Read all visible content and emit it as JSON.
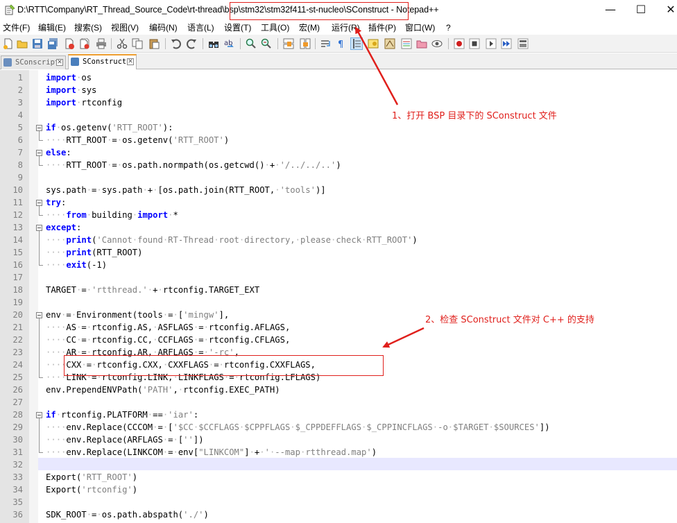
{
  "window": {
    "title_prefix": "D:\\RTT\\Company\\RT_Thread_Source_Code\\rt-thread\\",
    "title_highlight": "bsp\\stm32\\stm32f411-st-nucleo\\SConstruct",
    "title_suffix": " - Notepad++",
    "minimize": "—",
    "maximize": "☐",
    "close": "✕"
  },
  "menu": {
    "items": [
      "文件(F)",
      "编辑(E)",
      "搜索(S)",
      "视图(V)",
      "编码(N)",
      "语言(L)",
      "设置(T)",
      "工具(O)",
      "宏(M)",
      "运行(R)",
      "插件(P)",
      "窗口(W)",
      "?"
    ]
  },
  "tabs": [
    {
      "label": "SConscript",
      "active": false
    },
    {
      "label": "SConstruct",
      "active": true
    }
  ],
  "annotations": {
    "note1": "1、打开 BSP 目录下的 SConstruct 文件",
    "note2": "2、检查 SConstruct 文件对 C++ 的支持"
  },
  "editor": {
    "line_numbers": [
      "1",
      "2",
      "3",
      "4",
      "5",
      "6",
      "7",
      "8",
      "9",
      "10",
      "11",
      "12",
      "13",
      "14",
      "15",
      "16",
      "17",
      "18",
      "19",
      "20",
      "21",
      "22",
      "23",
      "24",
      "25",
      "26",
      "27",
      "28",
      "29",
      "30",
      "31",
      "32",
      "33",
      "34",
      "35",
      "36"
    ],
    "current_line": "32",
    "lines": [
      "import os",
      "import sys",
      "import rtconfig",
      "",
      "if os.getenv('RTT_ROOT'):",
      "    RTT_ROOT = os.getenv('RTT_ROOT')",
      "else:",
      "    RTT_ROOT = os.path.normpath(os.getcwd() + '/../../..')",
      "",
      "sys.path = sys.path + [os.path.join(RTT_ROOT, 'tools')]",
      "try:",
      "    from building import *",
      "except:",
      "    print('Cannot found RT-Thread root directory, please check RTT_ROOT')",
      "    print(RTT_ROOT)",
      "    exit(-1)",
      "",
      "TARGET = 'rtthread.' + rtconfig.TARGET_EXT",
      "",
      "env = Environment(tools = ['mingw'],",
      "    AS = rtconfig.AS, ASFLAGS = rtconfig.AFLAGS,",
      "    CC = rtconfig.CC, CCFLAGS = rtconfig.CFLAGS,",
      "    AR = rtconfig.AR, ARFLAGS = '-rc',",
      "    CXX = rtconfig.CXX, CXXFLAGS = rtconfig.CXXFLAGS,",
      "    LINK = rtconfig.LINK, LINKFLAGS = rtconfig.LFLAGS)",
      "env.PrependENVPath('PATH', rtconfig.EXEC_PATH)",
      "",
      "if rtconfig.PLATFORM == 'iar':",
      "    env.Replace(CCCOM = ['$CC $CCFLAGS $CPPFLAGS $_CPPDEFFLAGS $_CPPINCFLAGS -o $TARGET $SOURCES'])",
      "    env.Replace(ARFLAGS = [''])",
      "    env.Replace(LINKCOM = env[\"LINKCOM\"] + ' --map rtthread.map')",
      "",
      "Export('RTT_ROOT')",
      "Export('rtconfig')",
      "",
      "SDK_ROOT = os.path.abspath('./')"
    ]
  },
  "colors": {
    "keyword": "#0000ff",
    "string": "#808080",
    "annotation": "#e0201c",
    "current_line": "#e8e8ff"
  }
}
